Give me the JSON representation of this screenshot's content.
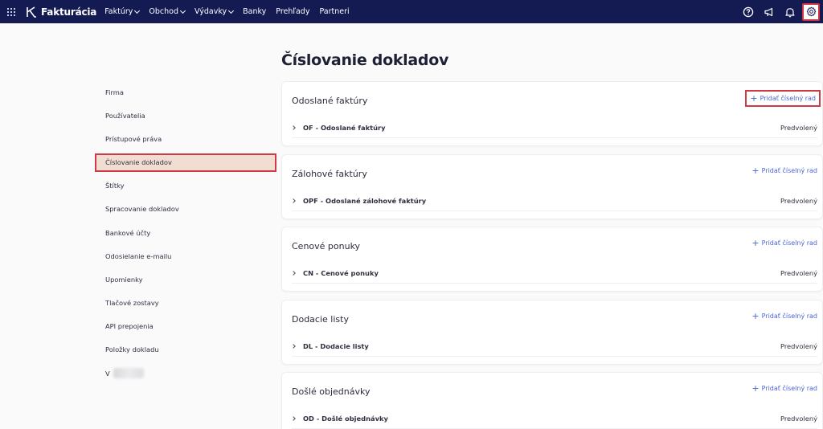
{
  "brand": "Fakturácia",
  "nav": [
    {
      "label": "Faktúry"
    },
    {
      "label": "Obchod"
    },
    {
      "label": "Výdavky"
    },
    {
      "label": "Banky"
    },
    {
      "label": "Prehľady"
    },
    {
      "label": "Partneri"
    }
  ],
  "page_title": "Číslovanie dokladov",
  "sidebar": {
    "items": [
      {
        "label": "Firma"
      },
      {
        "label": "Používatelia"
      },
      {
        "label": "Prístupové práva"
      },
      {
        "label": "Číslovanie dokladov"
      },
      {
        "label": "Štítky"
      },
      {
        "label": "Spracovanie dokladov"
      },
      {
        "label": "Bankové účty"
      },
      {
        "label": "Odosielanie e-mailu"
      },
      {
        "label": "Upomienky"
      },
      {
        "label": "Tlačové zostavy"
      },
      {
        "label": "API prepojenia"
      },
      {
        "label": "Položky dokladu"
      },
      {
        "label": "V"
      }
    ]
  },
  "add_label": "Pridať číselný rad",
  "sections": [
    {
      "title": "Odoslané faktúry",
      "row": {
        "name": "OF - Odoslané faktúry",
        "status": "Predvolený"
      }
    },
    {
      "title": "Zálohové faktúry",
      "row": {
        "name": "OPF - Odoslané zálohové faktúry",
        "status": "Predvolený"
      }
    },
    {
      "title": "Cenové ponuky",
      "row": {
        "name": "CN - Cenové ponuky",
        "status": "Predvolený"
      }
    },
    {
      "title": "Dodacie listy",
      "row": {
        "name": "DL - Dodacie listy",
        "status": "Predvolený"
      }
    },
    {
      "title": "Došlé objednávky",
      "row": {
        "name": "OD - Došlé objednávky",
        "status": "Predvolený"
      }
    }
  ],
  "colors": {
    "topbar": "#141b53",
    "accent": "#4b63d8",
    "highlight": "#cf3b45",
    "active_bg": "#f2ddd3"
  },
  "icons": [
    "apps-grid-icon",
    "logo-icon",
    "help-icon",
    "megaphone-icon",
    "bell-icon",
    "gear-icon",
    "chevron-down-icon",
    "chevron-right-icon",
    "plus-icon"
  ]
}
